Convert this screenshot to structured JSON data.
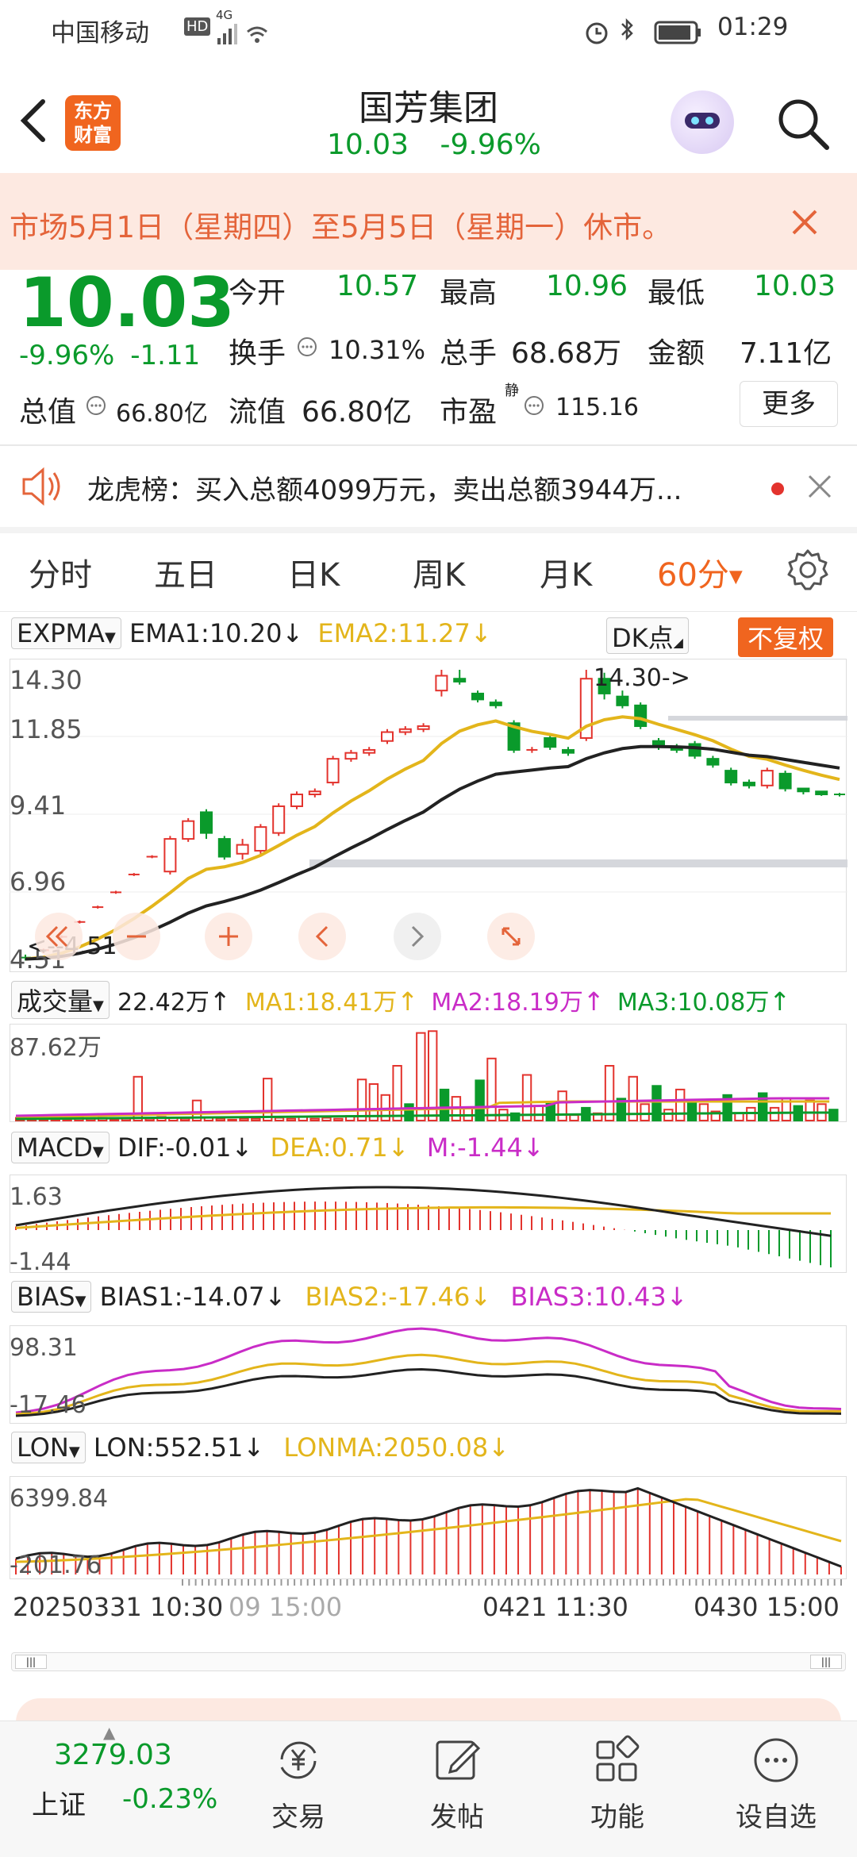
{
  "status": {
    "carrier": "中国移动",
    "net": "HD",
    "sig": "4G",
    "time": "01:29"
  },
  "header": {
    "title": "国芳集团",
    "price": "10.03",
    "change_pct": "-9.96%",
    "brand_top": "东方",
    "brand_bottom": "财富"
  },
  "notice": {
    "text": "市场5月1日（星期四）至5月5日（星期一）休市。"
  },
  "quote": {
    "last": "10.03",
    "pct": "-9.96%",
    "chg": "-1.11",
    "open_l": "今开",
    "open_v": "10.57",
    "high_l": "最高",
    "high_v": "10.96",
    "low_l": "最低",
    "low_v": "10.03",
    "turn_l": "换手",
    "turn_v": "10.31%",
    "vol_l": "总手",
    "vol_v": "68.68万",
    "amt_l": "金额",
    "amt_v": "7.11亿",
    "cap_l": "总值",
    "cap_v": "66.80亿",
    "float_l": "流值",
    "float_v": "66.80亿",
    "pe_l": "市盈",
    "pe_sup": "静",
    "pe_v": "115.16",
    "more": "更多"
  },
  "dragon": {
    "text": "龙虎榜：买入总额4099万元，卖出总额3944万..."
  },
  "tabs": [
    "分时",
    "五日",
    "日K",
    "周K",
    "月K",
    "60分"
  ],
  "expma": {
    "name": "EXPMA",
    "ema1": "EMA1:10.20",
    "ema2": "EMA2:11.27",
    "dk": "DK点",
    "fq": "不复权",
    "y_labels": [
      "14.30",
      "11.85",
      "9.41",
      "6.96",
      "4.51"
    ],
    "hi_tag": "14.30->",
    "lo_tag": "<--4.51"
  },
  "volume": {
    "name": "成交量",
    "val": "22.42万",
    "ma1": "MA1:18.41万",
    "ma2": "MA2:18.19万",
    "ma3": "MA3:10.08万",
    "y_top": "87.62万"
  },
  "macd": {
    "name": "MACD",
    "dif": "DIF:-0.01",
    "dea": "DEA:0.71",
    "m": "M:-1.44",
    "y_top": "1.63",
    "y_bot": "-1.44"
  },
  "bias": {
    "name": "BIAS",
    "b1": "BIAS1:-14.07",
    "b2": "BIAS2:-17.46",
    "b3": "BIAS3:10.43",
    "y_top": "98.31",
    "y_bot": "-17.46"
  },
  "lon": {
    "name": "LON",
    "lon": "LON:552.51",
    "lonma": "LONMA:2050.08",
    "y_top": "6399.84",
    "y_bot": "-201.76"
  },
  "xaxis": {
    "d1": "20250331 10:30",
    "d1b": "09 15:00",
    "d2": "0421 11:30",
    "d3": "0430 15:00"
  },
  "bottom": {
    "index_v": "3279.03",
    "index_n": "上证",
    "index_p": "-0.23%",
    "trade": "交易",
    "post": "发帖",
    "func": "功能",
    "watch": "设自选"
  },
  "colors": {
    "up": "#e3332d",
    "down": "#0a9a2b",
    "ema2": "#e3b51b",
    "accent": "#f0651f"
  }
}
